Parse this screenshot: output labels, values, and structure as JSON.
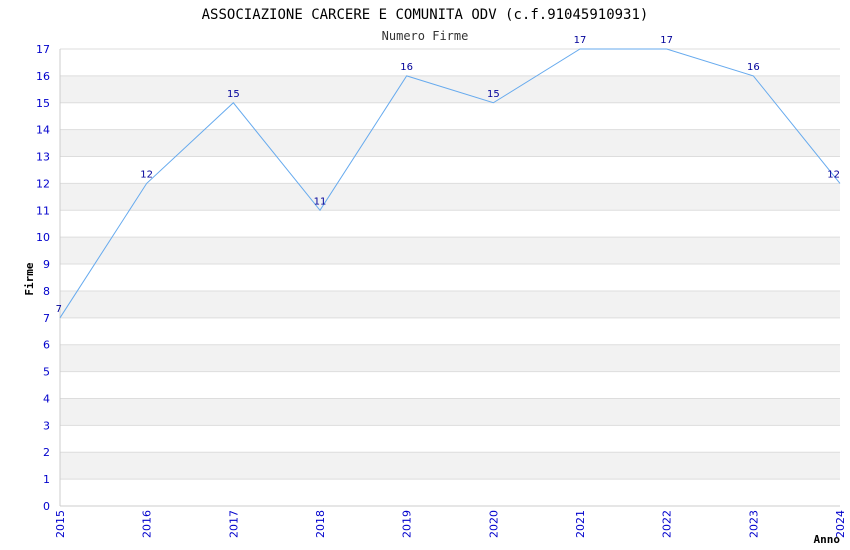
{
  "colors": {
    "band": "#f2f2f2",
    "gridline": "#dddddd",
    "line": "#66aaee",
    "tick": "#0000cc",
    "point_label": "#000099"
  },
  "chart_data": {
    "type": "line",
    "title": "ASSOCIAZIONE CARCERE E COMUNITA ODV (c.f.91045910931)",
    "subtitle": "Numero Firme",
    "xlabel": "Anno",
    "ylabel": "Firme",
    "x": [
      "2015",
      "2016",
      "2017",
      "2018",
      "2019",
      "2020",
      "2021",
      "2022",
      "2023",
      "2024"
    ],
    "series": [
      {
        "values": [
          7,
          12,
          15,
          11,
          16,
          15,
          17,
          17,
          16,
          12
        ]
      }
    ],
    "ylim": [
      0,
      17
    ],
    "yticks": [
      0,
      1,
      2,
      3,
      4,
      5,
      6,
      7,
      8,
      9,
      10,
      11,
      12,
      13,
      14,
      15,
      16,
      17
    ],
    "grid": true,
    "legend": "none"
  }
}
